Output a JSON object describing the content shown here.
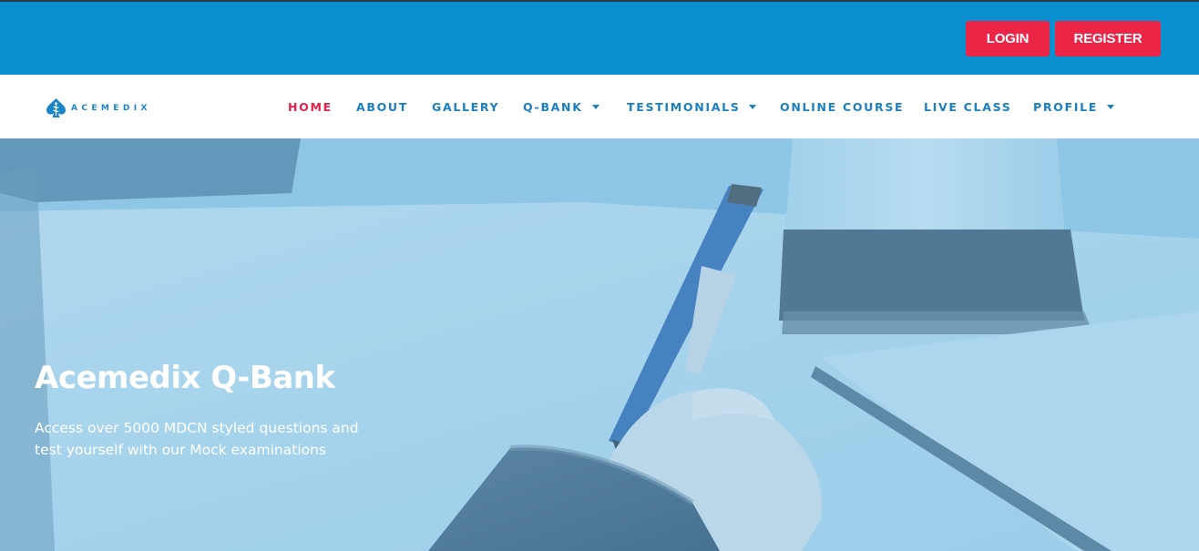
{
  "topbar": {
    "login_label": "LOGIN",
    "register_label": "REGISTER",
    "background_color": "#0a8fd1",
    "button_color": "#ec2547"
  },
  "brand": {
    "logo_text": "ACEMEDIX",
    "logo_icon": "spade-caduceus-icon"
  },
  "nav": {
    "items": [
      {
        "label": "HOME",
        "active": true
      },
      {
        "label": "ABOUT"
      },
      {
        "label": "GALLERY"
      },
      {
        "label": "Q-BANK",
        "dropdown": true
      },
      {
        "label": "TESTIMONIALS",
        "dropdown": true
      },
      {
        "label": "ONLINE COURSE"
      },
      {
        "label": "LIVE CLASS"
      },
      {
        "label": "PROFILE",
        "dropdown": true
      }
    ],
    "active_color": "#e4224a",
    "color": "#1b7fc0"
  },
  "hero": {
    "title": "Acemedix Q-Bank",
    "subtitle": "Access over 5000 MDCN styled questions and test yourself with our Mock examinations",
    "overlay_color": "#8ec6e6"
  }
}
